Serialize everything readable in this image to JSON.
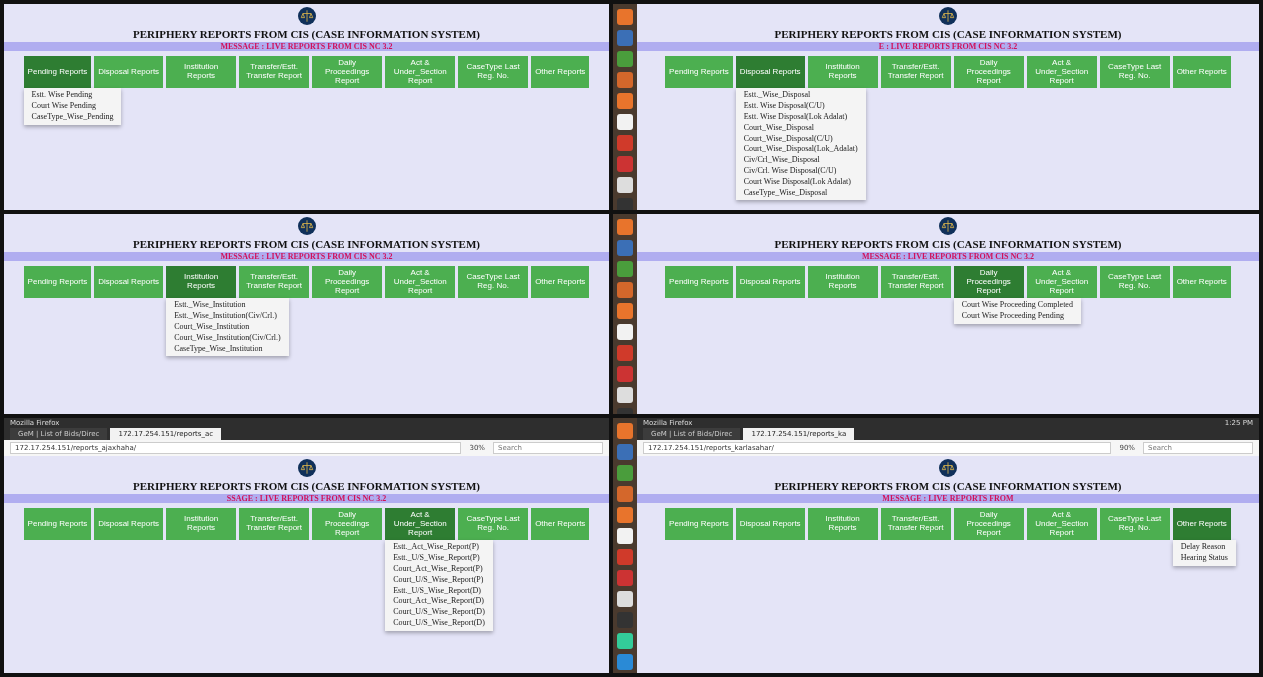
{
  "panels": [
    {
      "launcher": false,
      "title": "PERIPHERY REPORTS FROM CIS (CASE INFORMATION SYSTEM)",
      "message": "MESSAGE : LIVE REPORTS FROM CIS NC 3.2",
      "menu": [
        {
          "label": "Pending Reports",
          "selected": true
        },
        {
          "label": "Disposal Reports",
          "selected": false
        },
        {
          "label": "Institution Reports",
          "selected": false
        },
        {
          "label": "Transfer/Estt. Transfer Report",
          "selected": false
        },
        {
          "label": "Daily Proceedings Report",
          "selected": false
        },
        {
          "label": "Act & Under_Section Report",
          "selected": false
        },
        {
          "label": "CaseType Last Reg. No.",
          "selected": false
        },
        {
          "label": "Other Reports",
          "selected": false
        }
      ],
      "dropdown": [
        "Estt. Wise Pending",
        "Court Wise Pending",
        "CaseType_Wise_Pending"
      ]
    },
    {
      "launcher": true,
      "title": "PERIPHERY REPORTS FROM CIS (CASE INFORMATION SYSTEM)",
      "message": "E : LIVE REPORTS FROM CIS NC 3.2",
      "menu": [
        {
          "label": "Pending Reports",
          "selected": false
        },
        {
          "label": "Disposal Reports",
          "selected": true
        },
        {
          "label": "Institution Reports",
          "selected": false
        },
        {
          "label": "Transfer/Estt. Transfer Report",
          "selected": false
        },
        {
          "label": "Daily Proceedings Report",
          "selected": false
        },
        {
          "label": "Act & Under_Section Report",
          "selected": false
        },
        {
          "label": "CaseType Last Reg. No.",
          "selected": false
        },
        {
          "label": "Other Reports",
          "selected": false
        }
      ],
      "dropdown": [
        "Estt._Wise_Disposal",
        "Estt. Wise Disposal(C/U)",
        "Estt. Wise Disposal(Lok Adalat)",
        "Court_Wise_Disposal",
        "Court_Wise_Disposal(C/U)",
        "Court_Wise_Disposal(Lok_Adalat)",
        "Civ/Crl_Wise_Disposal",
        "Civ/Crl. Wise Disposal(C/U)",
        "Court Wise Disposal(Lok Adalat)",
        "CaseType_Wise_Disposal"
      ]
    },
    {
      "launcher": false,
      "title": "PERIPHERY REPORTS FROM CIS (CASE INFORMATION SYSTEM)",
      "message": "MESSAGE : LIVE REPORTS FROM CIS NC 3.2",
      "menu": [
        {
          "label": "Pending Reports",
          "selected": false
        },
        {
          "label": "Disposal Reports",
          "selected": false
        },
        {
          "label": "Institution Reports",
          "selected": true
        },
        {
          "label": "Transfer/Estt. Transfer Report",
          "selected": false
        },
        {
          "label": "Daily Proceedings Report",
          "selected": false
        },
        {
          "label": "Act & Under_Section Report",
          "selected": false
        },
        {
          "label": "CaseType Last Reg. No.",
          "selected": false
        },
        {
          "label": "Other Reports",
          "selected": false
        }
      ],
      "dropdown": [
        "Estt._Wise_Institution",
        "Estt._Wise_Institution(Civ/Crl.)",
        "Court_Wise_Institution",
        "Court_Wise_Institution(Civ/Crl.)",
        "CaseType_Wise_Institution"
      ]
    },
    {
      "launcher": true,
      "title": "PERIPHERY REPORTS FROM CIS (CASE INFORMATION SYSTEM)",
      "message": "MESSAGE : LIVE REPORTS FROM CIS NC 3.2",
      "menu": [
        {
          "label": "Pending Reports",
          "selected": false
        },
        {
          "label": "Disposal Reports",
          "selected": false
        },
        {
          "label": "Institution Reports",
          "selected": false
        },
        {
          "label": "Transfer/Estt. Transfer Report",
          "selected": false
        },
        {
          "label": "Daily Proceedings Report",
          "selected": true
        },
        {
          "label": "Act & Under_Section Report",
          "selected": false
        },
        {
          "label": "CaseType Last Reg. No.",
          "selected": false
        },
        {
          "label": "Other Reports",
          "selected": false
        }
      ],
      "dropdown": [
        "Court Wise Proceeding Completed",
        "Court Wise Proceeding Pending"
      ]
    },
    {
      "launcher": false,
      "browser": {
        "window_title": "Mozilla Firefox",
        "tabs": [
          {
            "label": "GeM | List of Bids/Direc",
            "selected": false
          },
          {
            "label": "172.17.254.151/reports_ac",
            "selected": true
          }
        ],
        "url": "172.17.254.151/reports_ajaxhaha/",
        "zoom": "30%",
        "search_placeholder": "Search"
      },
      "title": "PERIPHERY REPORTS FROM CIS (CASE INFORMATION SYSTEM)",
      "message": "SSAGE : LIVE REPORTS FROM CIS NC 3.2",
      "menu": [
        {
          "label": "Pending Reports",
          "selected": false
        },
        {
          "label": "Disposal Reports",
          "selected": false
        },
        {
          "label": "Institution Reports",
          "selected": false
        },
        {
          "label": "Transfer/Estt. Transfer Report",
          "selected": false
        },
        {
          "label": "Daily Proceedings Report",
          "selected": false
        },
        {
          "label": "Act & Under_Section Report",
          "selected": true
        },
        {
          "label": "CaseType Last Reg. No.",
          "selected": false
        },
        {
          "label": "Other Reports",
          "selected": false
        }
      ],
      "dropdown": [
        "Estt._Act_Wise_Report(P)",
        "Estt._U/S_Wise_Report(P)",
        "Court_Act_Wise_Report(P)",
        "Court_U/S_Wise_Report(P)",
        "Estt._U/S_Wise_Report(D)",
        "Court_Act_Wise_Report(D)",
        "Court_U/S_Wise_Report(D)",
        "Court_U/S_Wise_Report(D)"
      ]
    },
    {
      "launcher": true,
      "browser": {
        "window_title": "Mozilla Firefox",
        "tabs": [
          {
            "label": "GeM | List of Bids/Direc",
            "selected": false
          },
          {
            "label": "172.17.254.151/reports_ka",
            "selected": true
          }
        ],
        "url": "172.17.254.151/reports_karlasahar/",
        "zoom": "90%",
        "search_placeholder": "Search",
        "clock": "1:25 PM"
      },
      "title": "PERIPHERY REPORTS FROM CIS (CASE INFORMATION SYSTEM)",
      "message": "MESSAGE : LIVE REPORTS FROM",
      "menu": [
        {
          "label": "Pending Reports",
          "selected": false
        },
        {
          "label": "Disposal Reports",
          "selected": false
        },
        {
          "label": "Institution Reports",
          "selected": false
        },
        {
          "label": "Transfer/Estt. Transfer Report",
          "selected": false
        },
        {
          "label": "Daily Proceedings Report",
          "selected": false
        },
        {
          "label": "Act & Under_Section Report",
          "selected": false
        },
        {
          "label": "CaseType Last Reg. No.",
          "selected": false
        },
        {
          "label": "Other Reports",
          "selected": true
        }
      ],
      "dropdown": [
        "Delay Reason",
        "Hearing Status"
      ]
    }
  ]
}
